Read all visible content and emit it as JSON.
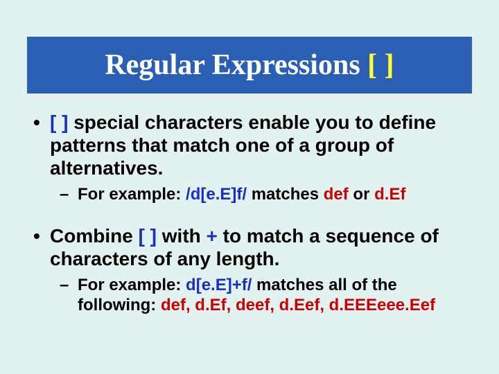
{
  "title": {
    "main": "Regular Expressions ",
    "brackets": "[ ]"
  },
  "bullets": {
    "b1": {
      "bracket": "[ ]",
      "rest": " special characters enable you to define patterns that match one of a group of alternatives.",
      "sub": {
        "prefix": "For example: ",
        "pattern": "/d[e.E]f/",
        "mid": "  matches ",
        "r1": "def",
        "or": " or ",
        "r2": "d.Ef"
      }
    },
    "b2": {
      "t1": "Combine ",
      "bracket": "[ ]",
      "t2": " with ",
      "plus": "+",
      "t3": " to match a sequence of characters of any length.",
      "sub": {
        "prefix": "For example: ",
        "pattern": "d[e.E]+f/",
        "mid": " matches all of the following: ",
        "results": "def, d.Ef, deef, d.Eef, d.EEEeee.Eef"
      }
    }
  }
}
